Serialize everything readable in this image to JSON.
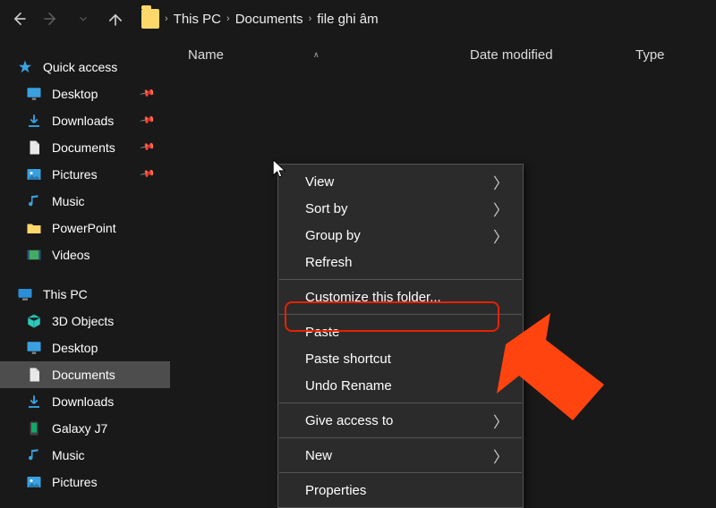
{
  "nav": {
    "breadcrumbs": [
      "This PC",
      "Documents",
      "file ghi âm"
    ]
  },
  "columns": {
    "name": "Name",
    "date": "Date modified",
    "type": "Type"
  },
  "sidebar": {
    "quickAccess": "Quick access",
    "qa_items": [
      {
        "label": "Desktop",
        "icon": "desktop",
        "pinned": true
      },
      {
        "label": "Downloads",
        "icon": "downloads",
        "pinned": true
      },
      {
        "label": "Documents",
        "icon": "documents",
        "pinned": true
      },
      {
        "label": "Pictures",
        "icon": "pictures",
        "pinned": true
      },
      {
        "label": "Music",
        "icon": "music",
        "pinned": false
      },
      {
        "label": "PowerPoint",
        "icon": "folder",
        "pinned": false
      },
      {
        "label": "Videos",
        "icon": "videos",
        "pinned": false
      }
    ],
    "thisPC": "This PC",
    "pc_items": [
      {
        "label": "3D Objects",
        "icon": "cube"
      },
      {
        "label": "Desktop",
        "icon": "desktop"
      },
      {
        "label": "Documents",
        "icon": "documents",
        "selected": true
      },
      {
        "label": "Downloads",
        "icon": "downloads"
      },
      {
        "label": "Galaxy J7",
        "icon": "phone"
      },
      {
        "label": "Music",
        "icon": "music"
      },
      {
        "label": "Pictures",
        "icon": "pictures"
      }
    ]
  },
  "contextMenu": {
    "items": [
      {
        "label": "View",
        "submenu": true
      },
      {
        "label": "Sort by",
        "submenu": true
      },
      {
        "label": "Group by",
        "submenu": true
      },
      {
        "label": "Refresh",
        "submenu": false
      },
      {
        "sep": true
      },
      {
        "label": "Customize this folder...",
        "submenu": false
      },
      {
        "sep": true
      },
      {
        "label": "Paste",
        "submenu": false,
        "highlighted": true
      },
      {
        "label": "Paste shortcut",
        "submenu": false
      },
      {
        "label": "Undo Rename",
        "submenu": false
      },
      {
        "sep": true
      },
      {
        "label": "Give access to",
        "submenu": true
      },
      {
        "sep": true
      },
      {
        "label": "New",
        "submenu": true
      },
      {
        "sep": true
      },
      {
        "label": "Properties",
        "submenu": false
      }
    ]
  },
  "icons": {
    "star": "★",
    "desktop": "desktop",
    "downloads": "downloads",
    "documents": "documents",
    "pictures": "pictures",
    "music": "music",
    "folder": "folder",
    "videos": "videos",
    "cube": "cube",
    "phone": "phone",
    "pc": "pc"
  }
}
